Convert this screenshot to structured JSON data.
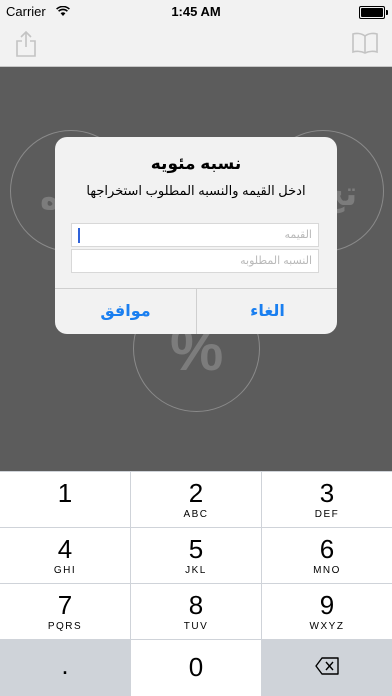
{
  "status_bar": {
    "carrier": "Carrier",
    "time": "1:45 AM"
  },
  "nav_bar": {
    "left_icon": "share-icon",
    "right_icon": "book-icon"
  },
  "background": {
    "left_circle_text": "ه",
    "right_circle_text": "تخ",
    "bottom_circle_text": "%"
  },
  "alert": {
    "title": "نسبه مئويه",
    "message": "ادخل القيمه والنسبه المطلوب استخراجها",
    "value_placeholder": "القيمه",
    "percent_placeholder": "النسبه المطلوبه",
    "ok_label": "موافق",
    "cancel_label": "الغاء"
  },
  "keyboard": {
    "keys": [
      {
        "digit": "1",
        "letters": ""
      },
      {
        "digit": "2",
        "letters": "ABC"
      },
      {
        "digit": "3",
        "letters": "DEF"
      },
      {
        "digit": "4",
        "letters": "GHI"
      },
      {
        "digit": "5",
        "letters": "JKL"
      },
      {
        "digit": "6",
        "letters": "MNO"
      },
      {
        "digit": "7",
        "letters": "PQRS"
      },
      {
        "digit": "8",
        "letters": "TUV"
      },
      {
        "digit": "9",
        "letters": "WXYZ"
      }
    ],
    "decimal": ".",
    "zero": "0",
    "delete_icon": "backspace-icon"
  }
}
